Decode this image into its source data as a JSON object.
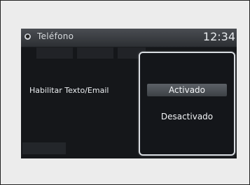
{
  "header": {
    "title": "Teléfono",
    "clock": "12:34",
    "icon": "phone-settings-icon"
  },
  "list": {
    "items": [
      {
        "label": "Habilitar Texto/Email",
        "active": true
      },
      {
        "label": "",
        "active": false
      },
      {
        "label": "",
        "active": false
      }
    ]
  },
  "popup": {
    "options": [
      {
        "label": "Activado",
        "selected": true
      },
      {
        "label": "Desactivado",
        "selected": false
      }
    ]
  },
  "colors": {
    "screen_bg": "#15171a",
    "highlight": "#4f5359",
    "text": "#eceff2"
  }
}
